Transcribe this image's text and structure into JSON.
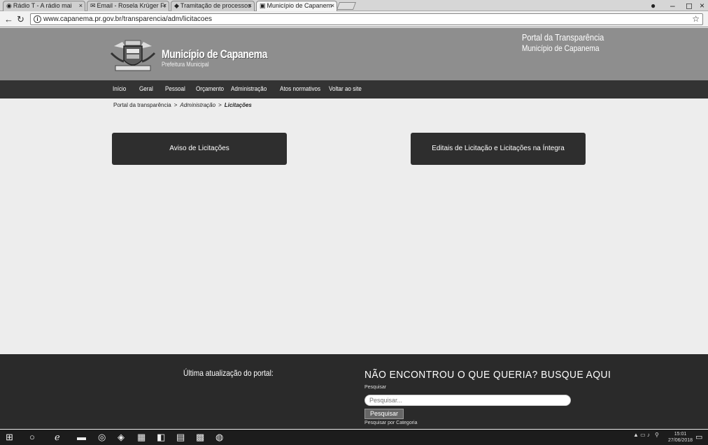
{
  "browser": {
    "tabs": [
      {
        "icon": "radio-icon",
        "glyph": "◉",
        "label": "Rádio T - A rádio mai"
      },
      {
        "icon": "mail-icon",
        "glyph": "✉",
        "label": "Email - Rosela Krüger Fr"
      },
      {
        "icon": "process-icon",
        "glyph": "◆",
        "label": "Tramitação de processos"
      },
      {
        "icon": "municipality-icon",
        "glyph": "▣",
        "label": "Município de Capanem"
      }
    ],
    "url": "www.capanema.pr.gov.br/transparencia/adm/licitacoes"
  },
  "header": {
    "site_name": "Município de Capanema",
    "site_sub": "Prefeitura Municipal",
    "portal_title": "Portal da Transparência",
    "portal_sub": "Município de Capanema"
  },
  "nav": {
    "items": [
      "Início",
      "Geral",
      "Pessoal",
      "Orçamento",
      "Administração",
      "Atos normativos",
      "Voltar ao site"
    ]
  },
  "breadcrumb": {
    "portal": "Portal da transparência",
    "section": "Administração",
    "current": "Licitações"
  },
  "content": {
    "btn_aviso": "Aviso de Licitações",
    "btn_editais": "Editais de Licitação e Licitações na Íntegra"
  },
  "footer": {
    "update_label": "Última atualização do portal:",
    "search_title": "NÃO ENCONTROU O QUE QUERIA? BUSQUE AQUI",
    "search_label": "Pesquisar",
    "search_placeholder": "Pesquisar...",
    "search_button": "Pesquisar",
    "category_link": "Pesquisar por Categoria"
  },
  "taskbar": {
    "time": "15:01",
    "date": "27/06/2018"
  },
  "colors": {
    "header_bg": "#8e8e8e",
    "nav_bg": "#333333",
    "button_bg": "#2e2e2e",
    "footer_bg": "#2a2a2a"
  }
}
